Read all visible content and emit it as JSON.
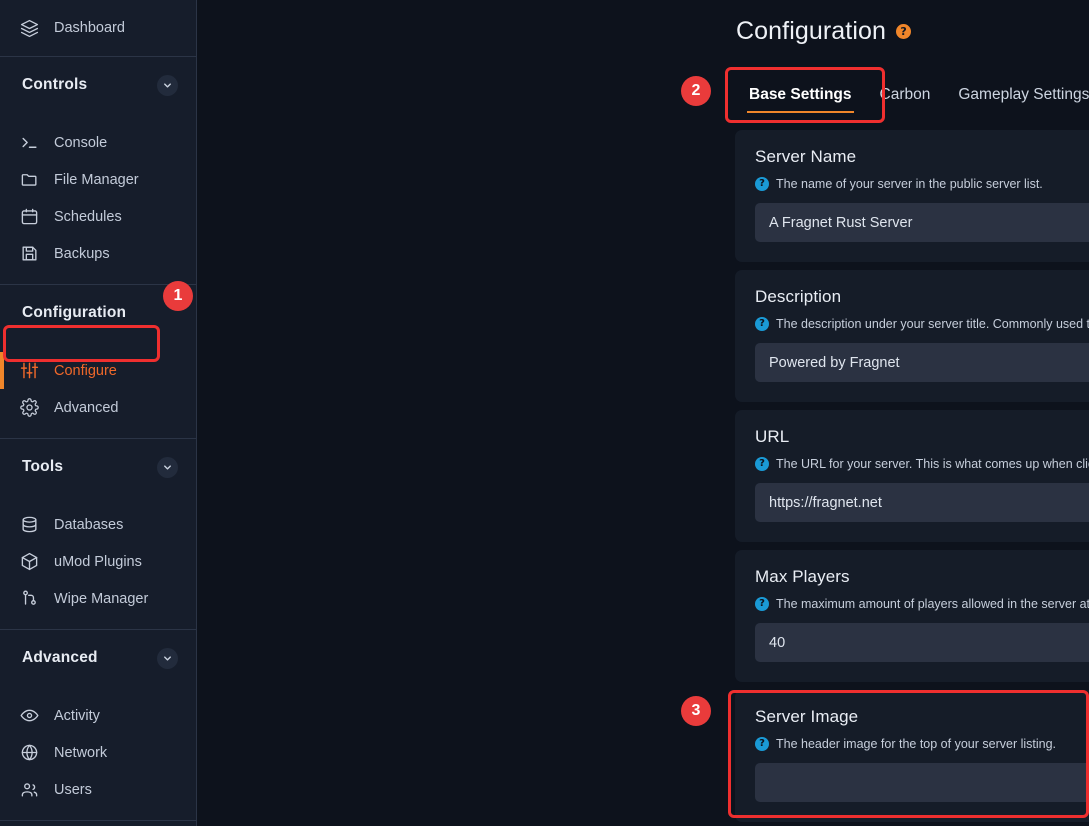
{
  "sidebar": {
    "dashboard": {
      "label": "Dashboard",
      "icon": "layers-icon"
    },
    "groups": [
      {
        "header": "Controls",
        "items": [
          {
            "label": "Console",
            "icon": "terminal-icon",
            "active": false
          },
          {
            "label": "File Manager",
            "icon": "folder-icon",
            "active": false
          },
          {
            "label": "Schedules",
            "icon": "calendar-icon",
            "active": false
          },
          {
            "label": "Backups",
            "icon": "save-icon",
            "active": false
          }
        ]
      },
      {
        "header": "Configuration",
        "items": [
          {
            "label": "Configure",
            "icon": "sliders-icon",
            "active": true
          },
          {
            "label": "Advanced",
            "icon": "gear-icon",
            "active": false
          }
        ]
      },
      {
        "header": "Tools",
        "items": [
          {
            "label": "Databases",
            "icon": "database-icon",
            "active": false
          },
          {
            "label": "uMod Plugins",
            "icon": "package-icon",
            "active": false
          },
          {
            "label": "Wipe Manager",
            "icon": "git-branch-icon",
            "active": false
          }
        ]
      },
      {
        "header": "Advanced",
        "items": [
          {
            "label": "Activity",
            "icon": "eye-icon",
            "active": false
          },
          {
            "label": "Network",
            "icon": "globe-icon",
            "active": false
          },
          {
            "label": "Users",
            "icon": "users-icon",
            "active": false
          }
        ]
      }
    ]
  },
  "header": {
    "title": "Configuration",
    "help_icon_char": "?"
  },
  "tabs": [
    {
      "label": "Base Settings",
      "active": true
    },
    {
      "label": "Carbon",
      "active": false
    },
    {
      "label": "Gameplay Settings",
      "active": false
    }
  ],
  "cards": [
    {
      "title": "Server Name",
      "hint": "The name of your server in the public server list.",
      "value": "A Fragnet Rust Server"
    },
    {
      "title": "Description",
      "hint": "The description under your server title. Commonly used t",
      "value": "Powered by Fragnet"
    },
    {
      "title": "URL",
      "hint": "The URL for your server. This is what comes up when clic",
      "value": "https://fragnet.net"
    },
    {
      "title": "Max Players",
      "hint": "The maximum amount of players allowed in the server at",
      "value": "40"
    },
    {
      "title": "Server Image",
      "hint": "The header image for the top of your server listing.",
      "value": ""
    }
  ],
  "annotations": {
    "badges": [
      {
        "number": "1"
      },
      {
        "number": "2"
      },
      {
        "number": "3"
      }
    ]
  },
  "colors": {
    "accent_orange": "#f0862a",
    "highlight_red": "#ef2f2f",
    "badge_red": "#e93b3b",
    "help_blue": "#1a9ad6",
    "sidebar_bg": "#161d2b",
    "main_bg": "#0d121c",
    "card_bg": "#151c28",
    "input_bg": "#2b3242"
  }
}
